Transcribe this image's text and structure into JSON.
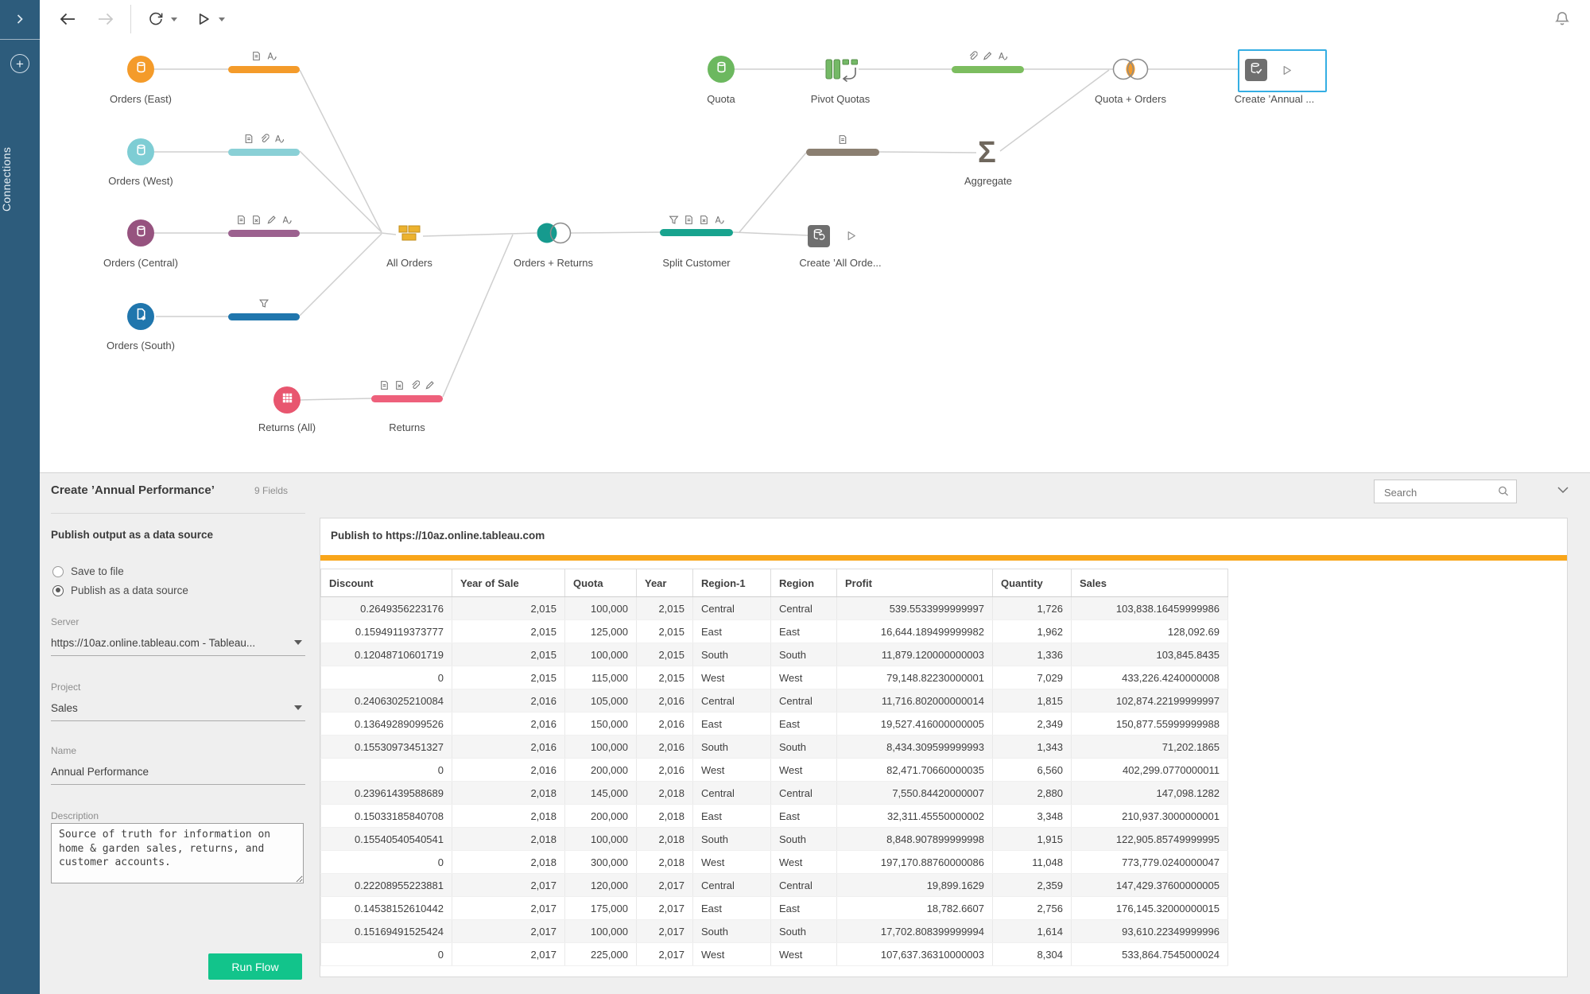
{
  "colors": {
    "sidebar_blue": "#2d5c7c",
    "accent_orange": "#f9a61a",
    "selection_blue": "#35aee3",
    "run_button_green": "#12c48b",
    "orders_east_orange": "#f49b2a",
    "orders_west_teal": "#7ecdd4",
    "orders_central_plum": "#96537f",
    "orders_south_blue": "#2076ad",
    "returns_pink": "#e8566f",
    "split_teal": "#18a38e",
    "quota_green": "#6cb85f",
    "gray_taupe_bar": "#8b7f71",
    "union_yellow": "#ecb22e"
  },
  "sidebar": {
    "title": "Connections"
  },
  "icons": {
    "aggregate_sigma": "Σ"
  },
  "flow": {
    "nodes": [
      {
        "label": "Orders (East)"
      },
      {
        "label": "Orders (West)"
      },
      {
        "label": "Orders (Central)"
      },
      {
        "label": "Orders (South)"
      },
      {
        "label": "Returns (All)"
      },
      {
        "label": "Returns"
      },
      {
        "label": "All Orders"
      },
      {
        "label": "Orders + Returns"
      },
      {
        "label": "Split Customer"
      },
      {
        "label": "Create ’All Orde..."
      },
      {
        "label": "Quota"
      },
      {
        "label": "Pivot Quotas"
      },
      {
        "label": "Aggregate"
      },
      {
        "label": "Quota + Orders"
      },
      {
        "label": "Create ’Annual ..."
      }
    ]
  },
  "panel": {
    "title": "Create ’Annual Performance’",
    "field_count": "9 Fields",
    "search_placeholder": "Search",
    "form": {
      "section_title": "Publish output as a data source",
      "radio_save": "Save to file",
      "radio_publish": "Publish as a data source",
      "server_label": "Server",
      "server_value": "https://10az.online.tableau.com - Tableau...",
      "project_label": "Project",
      "project_value": "Sales",
      "name_label": "Name",
      "name_value": "Annual Performance",
      "description_label": "Description",
      "description_value": "Source of truth for information on home & garden sales, returns, and customer accounts.",
      "run_button": "Run Flow"
    },
    "card": {
      "publish_title": "Publish to https://10az.online.tableau.com",
      "columns": [
        "Discount",
        "Year of Sale",
        "Quota",
        "Year",
        "Region-1",
        "Region",
        "Profit",
        "Quantity",
        "Sales"
      ],
      "rows": [
        [
          "0.2649356223176",
          "2,015",
          "100,000",
          "2,015",
          "Central",
          "Central",
          "539.5533999999997",
          "1,726",
          "103,838.16459999986"
        ],
        [
          "0.15949119373777",
          "2,015",
          "125,000",
          "2,015",
          "East",
          "East",
          "16,644.189499999982",
          "1,962",
          "128,092.69"
        ],
        [
          "0.12048710601719",
          "2,015",
          "100,000",
          "2,015",
          "South",
          "South",
          "11,879.120000000003",
          "1,336",
          "103,845.8435"
        ],
        [
          "0",
          "2,015",
          "115,000",
          "2,015",
          "West",
          "West",
          "79,148.82230000001",
          "7,029",
          "433,226.4240000008"
        ],
        [
          "0.24063025210084",
          "2,016",
          "105,000",
          "2,016",
          "Central",
          "Central",
          "11,716.802000000014",
          "1,815",
          "102,874.22199999997"
        ],
        [
          "0.13649289099526",
          "2,016",
          "150,000",
          "2,016",
          "East",
          "East",
          "19,527.416000000005",
          "2,349",
          "150,877.55999999988"
        ],
        [
          "0.15530973451327",
          "2,016",
          "100,000",
          "2,016",
          "South",
          "South",
          "8,434.309599999993",
          "1,343",
          "71,202.1865"
        ],
        [
          "0",
          "2,016",
          "200,000",
          "2,016",
          "West",
          "West",
          "82,471.70660000035",
          "6,560",
          "402,299.0770000011"
        ],
        [
          "0.23961439588689",
          "2,018",
          "145,000",
          "2,018",
          "Central",
          "Central",
          "7,550.84420000007",
          "2,880",
          "147,098.1282"
        ],
        [
          "0.15033185840708",
          "2,018",
          "200,000",
          "2,018",
          "East",
          "East",
          "32,311.45550000002",
          "3,348",
          "210,937.3000000001"
        ],
        [
          "0.15540540540541",
          "2,018",
          "100,000",
          "2,018",
          "South",
          "South",
          "8,848.907899999998",
          "1,915",
          "122,905.85749999995"
        ],
        [
          "0",
          "2,018",
          "300,000",
          "2,018",
          "West",
          "West",
          "197,170.88760000086",
          "11,048",
          "773,779.0240000047"
        ],
        [
          "0.22208955223881",
          "2,017",
          "120,000",
          "2,017",
          "Central",
          "Central",
          "19,899.1629",
          "2,359",
          "147,429.37600000005"
        ],
        [
          "0.14538152610442",
          "2,017",
          "175,000",
          "2,017",
          "East",
          "East",
          "18,782.6607",
          "2,756",
          "176,145.32000000015"
        ],
        [
          "0.15169491525424",
          "2,017",
          "100,000",
          "2,017",
          "South",
          "South",
          "17,702.808399999994",
          "1,614",
          "93,610.22349999996"
        ],
        [
          "0",
          "2,017",
          "225,000",
          "2,017",
          "West",
          "West",
          "107,637.36310000003",
          "8,304",
          "533,864.7545000024"
        ]
      ]
    }
  }
}
